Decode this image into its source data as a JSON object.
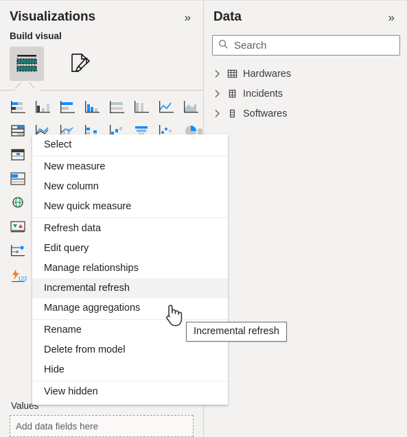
{
  "visualizations_pane": {
    "title": "Visualizations",
    "collapse_icon": "chevron-double-right-icon",
    "collapse_glyph": "»",
    "build_visual_label": "Build visual",
    "tabs": [
      {
        "name": "build-visual-tab",
        "icon": "table-visual-icon",
        "selected": true
      },
      {
        "name": "format-visual-tab",
        "icon": "paintbrush-page-icon",
        "selected": false
      }
    ],
    "gallery_rows": [
      [
        "stacked-bar-chart-icon",
        "stacked-column-chart-icon",
        "clustered-bar-chart-icon",
        "clustered-column-chart-icon",
        "hundred-percent-stacked-bar-chart-icon",
        "hundred-percent-stacked-column-chart-icon",
        "line-chart-icon",
        "area-chart-icon"
      ],
      [
        "table-icon",
        "line-and-stacked-column-chart-icon",
        "line-and-clustered-column-chart-icon",
        "ribbon-chart-icon",
        "waterfall-chart-icon",
        "funnel-chart-icon",
        "scatter-chart-icon",
        "pie-chart-icon"
      ],
      [
        "matrix-icon",
        "donut-chart-icon",
        "treemap-icon",
        "map-icon",
        "filled-map-icon",
        "gauge-icon",
        "card-icon",
        "multi-row-card-icon"
      ],
      [
        "card-visual-icon",
        "kpi-icon",
        "slicer-icon",
        "textbox-icon",
        "shape-icon",
        "python-visual-icon",
        "r-visual-icon",
        "key-influencers-icon"
      ],
      [
        "globe-map-icon",
        "azure-map-icon",
        "arcgis-map-icon",
        "decomposition-tree-icon",
        "qna-icon",
        "smart-narrative-icon",
        "metrics-icon",
        "paginated-report-icon"
      ],
      [
        "kpi-arrows-icon",
        "bar-target-icon",
        "power-apps-icon",
        "power-automate-icon",
        "get-more-visuals-icon",
        "build-your-own-icon",
        "import-visual-icon",
        "more-options-icon"
      ],
      [
        "decomposition-icon",
        "hierarchy-slicer-icon",
        "radio-slicer-icon",
        "list-slicer-icon",
        "dropdown-slicer-icon",
        "range-slicer-icon",
        "relative-date-icon",
        "button-slicer-icon"
      ],
      [
        "dax-measure-icon",
        "numeric-field-icon",
        "calculation-icon",
        "field-parameter-icon",
        "quick-measure-icon",
        "calc-group-icon",
        "model-icon",
        "dataset-icon"
      ]
    ],
    "well": {
      "title": "Values",
      "title_clipped": "Val",
      "placeholder": "Add data fields here",
      "placeholder_clipped": "Ad"
    }
  },
  "data_pane": {
    "title": "Data",
    "collapse_icon": "chevron-double-right-icon",
    "collapse_glyph": "»",
    "search": {
      "placeholder": "Search",
      "value": "",
      "icon": "search-icon"
    },
    "tables": [
      {
        "label": "Hardwares",
        "icon": "table-icon",
        "expanded": false,
        "chevron": "chevron-right-icon"
      },
      {
        "label": "Incidents",
        "icon": "table-icon",
        "expanded": false,
        "chevron": "chevron-right-icon"
      },
      {
        "label": "Softwares",
        "icon": "table-icon",
        "expanded": false,
        "chevron": "chevron-right-icon"
      }
    ]
  },
  "context_menu": {
    "items": [
      {
        "label": "Select",
        "hovered": false,
        "separator_after": true
      },
      {
        "label": "New measure",
        "hovered": false,
        "separator_after": false
      },
      {
        "label": "New column",
        "hovered": false,
        "separator_after": false
      },
      {
        "label": "New quick measure",
        "hovered": false,
        "separator_after": true
      },
      {
        "label": "Refresh data",
        "hovered": false,
        "separator_after": false
      },
      {
        "label": "Edit query",
        "hovered": false,
        "separator_after": false
      },
      {
        "label": "Manage relationships",
        "hovered": false,
        "separator_after": false
      },
      {
        "label": "Incremental refresh",
        "hovered": true,
        "separator_after": false
      },
      {
        "label": "Manage aggregations",
        "hovered": false,
        "separator_after": true
      },
      {
        "label": "Rename",
        "hovered": false,
        "separator_after": false
      },
      {
        "label": "Delete from model",
        "hovered": false,
        "separator_after": false
      },
      {
        "label": "Hide",
        "hovered": false,
        "separator_after": true
      },
      {
        "label": "View hidden",
        "hovered": false,
        "separator_after": false
      }
    ]
  },
  "tooltip": {
    "text": "Incremental refresh"
  },
  "cursor": {
    "icon": "hand-pointer-cursor"
  },
  "colors": {
    "pane_background": "#f3f2f1",
    "menu_background": "#ffffff",
    "menu_hover": "#f3f2f1",
    "accent_teal": "#1d7874",
    "accent_blue": "#118dff",
    "text_primary": "#252423",
    "border": "#d6d3d1",
    "tooltip_border": "#6e6e6e"
  }
}
